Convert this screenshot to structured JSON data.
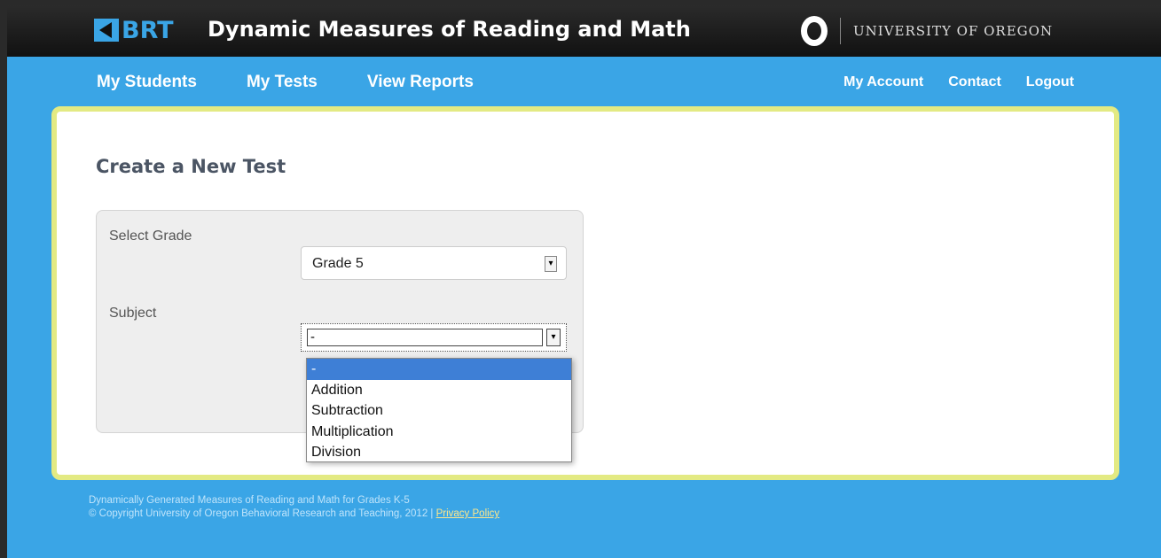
{
  "header": {
    "logo_text": "BRT",
    "site_title": "Dynamic Measures of Reading and Math",
    "university": "UNIVERSITY OF OREGON"
  },
  "nav": {
    "left": [
      "My Students",
      "My Tests",
      "View Reports"
    ],
    "right": [
      "My Account",
      "Contact",
      "Logout"
    ]
  },
  "main": {
    "title": "Create a New Test",
    "grade_label": "Select Grade",
    "grade_value": "Grade 5",
    "subject_label": "Subject",
    "subject_value": "-",
    "subject_options": [
      "-",
      "Addition",
      "Subtraction",
      "Multiplication",
      "Division"
    ]
  },
  "footer": {
    "line1": "Dynamically Generated Measures of Reading and Math for Grades K-5",
    "line2": "© Copyright University of Oregon Behavioral Research and Teaching, 2012 |",
    "privacy": "Privacy Policy"
  },
  "colors": {
    "background_blue": "#3aa5e6",
    "panel_border": "#e3ea83",
    "selected_option": "#3e7fd6"
  }
}
